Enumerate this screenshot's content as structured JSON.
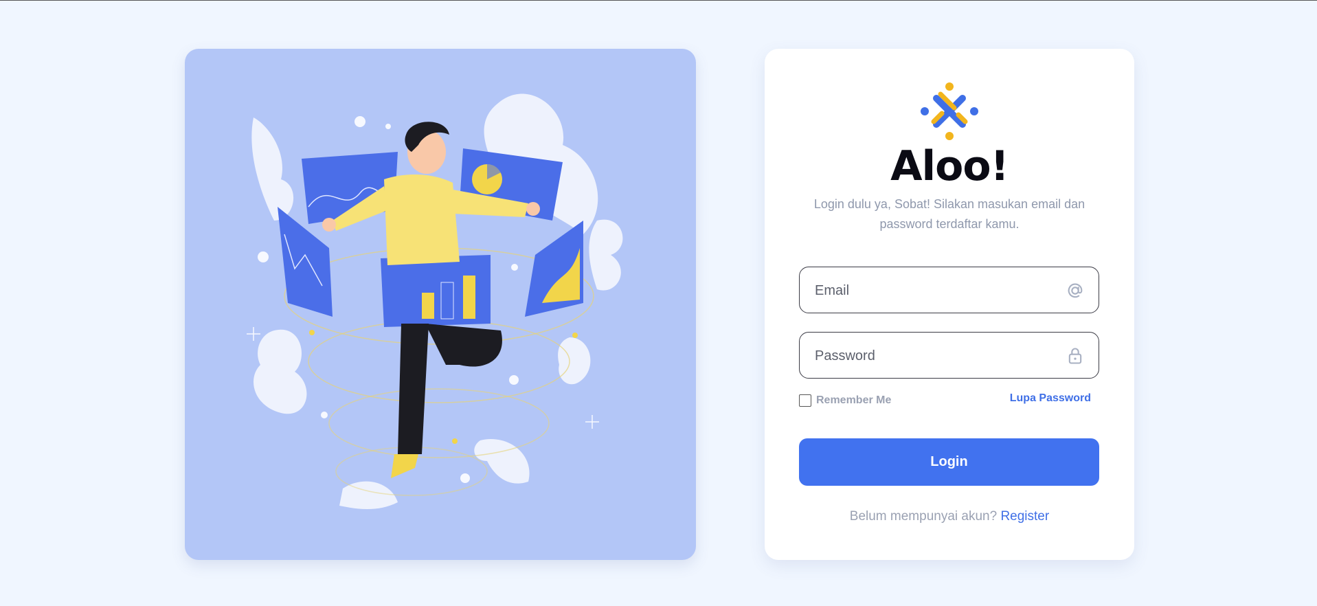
{
  "illustration": {
    "description_icon": "person-dashboard-illustration"
  },
  "login": {
    "logo_icon": "people-cross-logo-icon",
    "title": "Aloo!",
    "subtitle": "Login dulu ya, Sobat! Silakan masukan email dan password terdaftar kamu.",
    "email": {
      "placeholder": "Email",
      "value": "",
      "icon": "at-sign-icon"
    },
    "password": {
      "placeholder": "Password",
      "value": "",
      "icon": "lock-icon"
    },
    "remember_label": "Remember Me",
    "remember_checked": false,
    "forgot_label": "Lupa Password",
    "submit_label": "Login",
    "register_prompt": "Belum mempunyai akun?",
    "register_link": "Register"
  },
  "colors": {
    "page_bg": "#f0f6ff",
    "illustration_bg": "#b3c6f7",
    "accent": "#4172ef",
    "logo_yellow": "#f2b51d",
    "logo_blue": "#3f6fe6"
  }
}
